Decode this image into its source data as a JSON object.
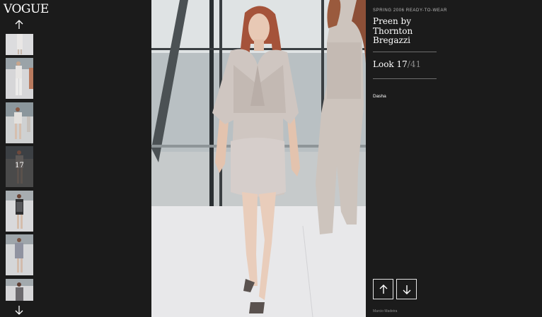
{
  "brand": {
    "logo_text": "VOGUE"
  },
  "rail": {
    "up_icon": "arrow-up-icon",
    "down_icon": "arrow-down-icon",
    "active_thumb_label": "17"
  },
  "show": {
    "season": "SPRING 2006 READY-TO-WEAR",
    "designer": "Preen by Thornton Bregazzi",
    "look_prefix": "Look ",
    "look_current": "17",
    "look_total": "/41",
    "model": "Dasha",
    "photo_credit": "Marcio Madeira"
  },
  "nav": {
    "prev_icon": "arrow-up-icon",
    "next_icon": "arrow-down-icon"
  },
  "colors": {
    "background": "#1b1b1b",
    "runway_floor": "#e8e8ea",
    "outfit": "#cfc6c1",
    "hair": "#a5533a"
  }
}
